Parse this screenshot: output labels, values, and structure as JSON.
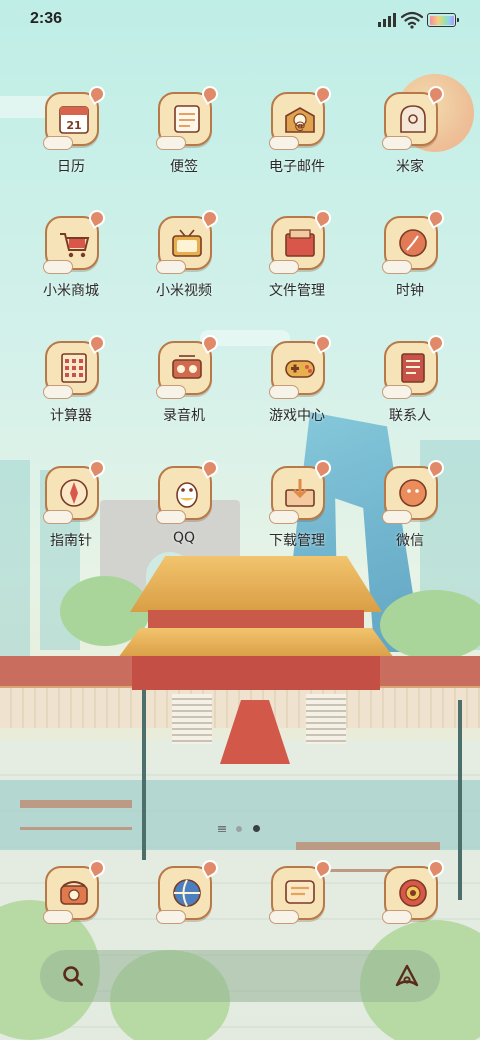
{
  "status_bar": {
    "time": "2:36"
  },
  "apps": [
    {
      "label": "日历",
      "icon": "calendar-icon",
      "accent": "#d9644e",
      "glyph": "21"
    },
    {
      "label": "便签",
      "icon": "notes-icon",
      "accent": "#e8a062",
      "glyph": ""
    },
    {
      "label": "电子邮件",
      "icon": "email-icon",
      "accent": "#e0a24e",
      "glyph": "@"
    },
    {
      "label": "米家",
      "icon": "mihome-icon",
      "accent": "#f4e9d8",
      "glyph": ""
    },
    {
      "label": "小米商城",
      "icon": "mall-icon",
      "accent": "#d9574a",
      "glyph": ""
    },
    {
      "label": "小米视频",
      "icon": "video-icon",
      "accent": "#e6b04c",
      "glyph": ""
    },
    {
      "label": "文件管理",
      "icon": "files-icon",
      "accent": "#d9574a",
      "glyph": ""
    },
    {
      "label": "时钟",
      "icon": "clock-icon",
      "accent": "#e27b55",
      "glyph": ""
    },
    {
      "label": "计算器",
      "icon": "calculator-icon",
      "accent": "#c8534a",
      "glyph": ""
    },
    {
      "label": "录音机",
      "icon": "recorder-icon",
      "accent": "#d06b50",
      "glyph": ""
    },
    {
      "label": "游戏中心",
      "icon": "gamepad-icon",
      "accent": "#e7b04e",
      "glyph": ""
    },
    {
      "label": "联系人",
      "icon": "contacts-icon",
      "accent": "#c8534a",
      "glyph": ""
    },
    {
      "label": "指南针",
      "icon": "compass-icon",
      "accent": "#d9574a",
      "glyph": ""
    },
    {
      "label": "QQ",
      "icon": "qq-icon",
      "accent": "#f0c050",
      "glyph": ""
    },
    {
      "label": "下载管理",
      "icon": "download-icon",
      "accent": "#e08a4a",
      "glyph": ""
    },
    {
      "label": "微信",
      "icon": "wechat-icon",
      "accent": "#ea8c5c",
      "glyph": ""
    }
  ],
  "dock": [
    {
      "icon": "phone-icon",
      "accent": "#e07a4e"
    },
    {
      "icon": "browser-icon",
      "accent": "#4b7fbf"
    },
    {
      "icon": "messages-icon",
      "accent": "#e6a45a"
    },
    {
      "icon": "camera-icon",
      "accent": "#d9574a"
    }
  ],
  "page_indicator": {
    "pages": 2,
    "current": 2
  },
  "colors": {
    "icon_bg": "#f6e4b8",
    "icon_border": "#b87948",
    "label": "#2b2b2b"
  }
}
